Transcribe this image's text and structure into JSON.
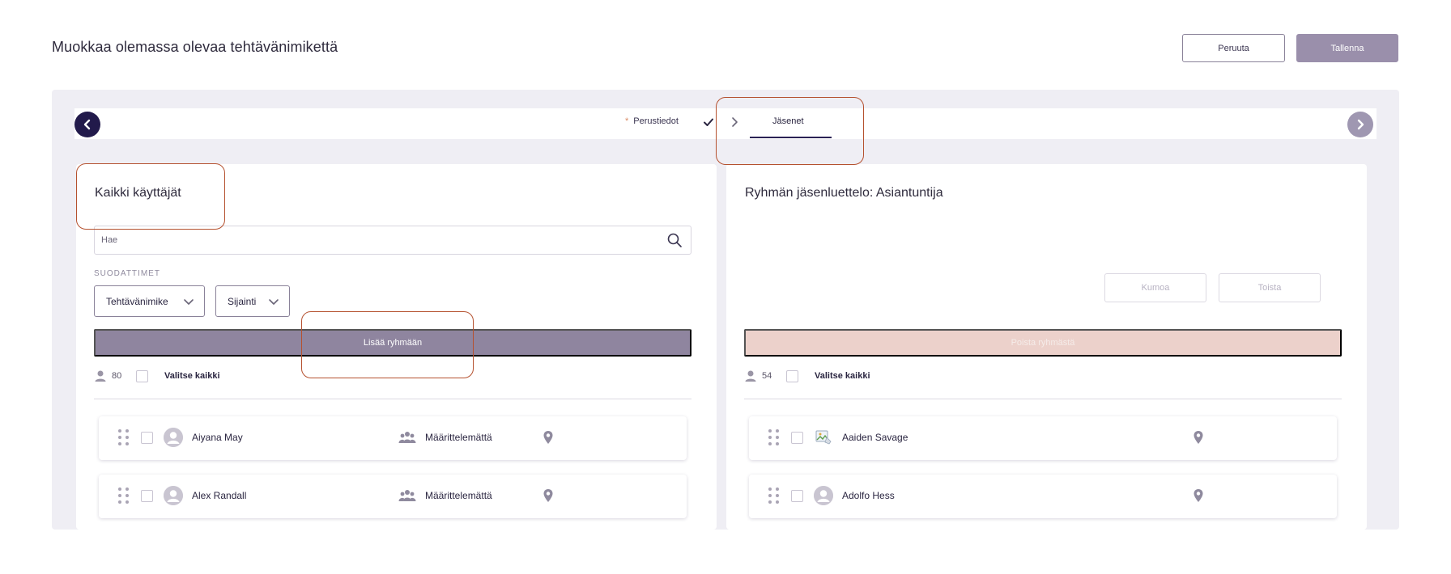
{
  "header": {
    "title": "Muokkaa olemassa olevaa tehtävänimikettä",
    "cancel_label": "Peruuta",
    "save_label": "Tallenna"
  },
  "stepper": {
    "steps": [
      {
        "label": "Perustiedot",
        "required_mark": "*",
        "completed": true
      },
      {
        "label": "Jäsenet",
        "active": true
      }
    ]
  },
  "left_panel": {
    "title": "Kaikki käyttäjät",
    "search_placeholder": "Hae",
    "filters_label": "SUODATTIMET",
    "filters": [
      "Tehtävänimike",
      "Sijainti"
    ],
    "action_label": "Lisää ryhmään",
    "count": "80",
    "select_all_label": "Valitse kaikki",
    "users": [
      {
        "name": "Aiyana May",
        "group": "Määrittelemättä"
      },
      {
        "name": "Alex Randall",
        "group": "Määrittelemättä"
      }
    ]
  },
  "right_panel": {
    "title": "Ryhmän jäsenluettelo: Asiantuntija",
    "undo_label": "Kumoa",
    "redo_label": "Toista",
    "action_label": "Poista ryhmästä",
    "count": "54",
    "select_all_label": "Valitse kaikki",
    "users": [
      {
        "name": "Aaiden Savage",
        "avatar": "broken-image"
      },
      {
        "name": "Adolfo Hess",
        "avatar": "default"
      }
    ]
  },
  "colors": {
    "primary_dark": "#221a4b",
    "accent": "#8f859f",
    "remove_disabled": "#ecd1cb",
    "highlight": "#b5512f"
  }
}
